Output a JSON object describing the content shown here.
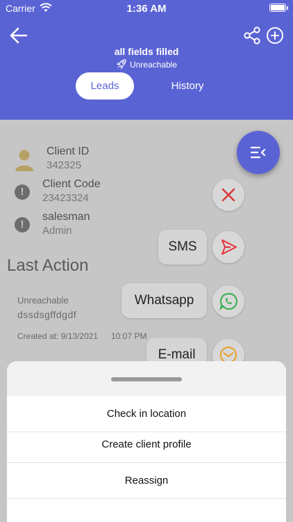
{
  "status_bar": {
    "carrier": "Carrier",
    "time": "1:36 AM"
  },
  "header": {
    "title": "all fields filled",
    "subtitle": "Unreachable",
    "tabs": [
      {
        "label": "Leads",
        "active": true
      },
      {
        "label": "History",
        "active": false
      }
    ],
    "accent_color": "#5a63d4"
  },
  "client": {
    "id_label": "Client ID",
    "id_value": "342325",
    "code_label": "Client Code",
    "code_value": "23423324",
    "salesman_label": "salesman",
    "salesman_value": "Admin"
  },
  "last_action": {
    "title": "Last Action",
    "status": "Unreachable",
    "note": "dssdsgffdgdf",
    "created": "Created at: 9/13/2021",
    "time": "10:07 PM"
  },
  "speed_dial": {
    "sms_label": "SMS",
    "whatsapp_label": "Whatsapp",
    "email_label": "E-mail",
    "colors": {
      "close": "#d83a3a",
      "sms": "#e8303c",
      "whatsapp": "#2fae4a",
      "email": "#e8a020"
    }
  },
  "sheet": {
    "items": [
      "Check in location",
      "Create client profile",
      "Reassign"
    ]
  }
}
